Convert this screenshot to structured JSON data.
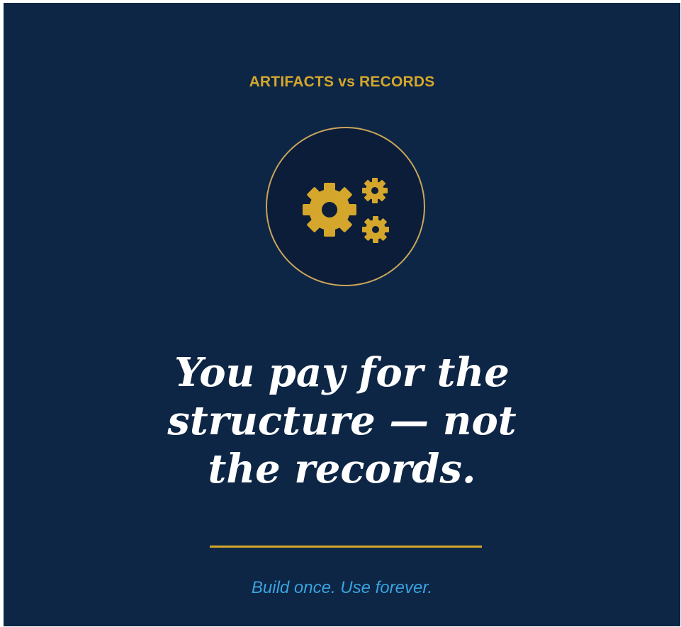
{
  "eyebrow": "ARTIFACTS vs RECORDS",
  "icon": "gears-icon",
  "headline": {
    "line1": "You pay for the",
    "line2": "structure — not",
    "line3": "the records."
  },
  "tagline": "Build once. Use forever.",
  "colors": {
    "background": "#0d2645",
    "accent_gold": "#d4a72c",
    "badge_fill": "#0c1d3a",
    "badge_border": "#c9a55a",
    "headline": "#ffffff",
    "tagline": "#3aa3e0"
  }
}
